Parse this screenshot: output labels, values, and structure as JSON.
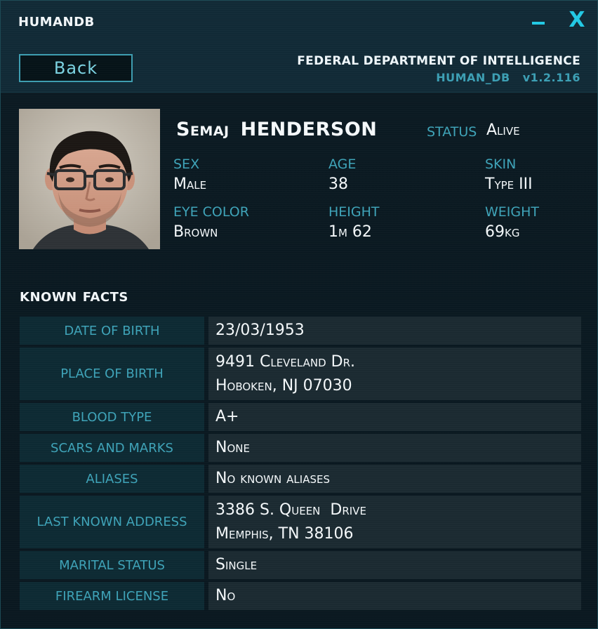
{
  "window": {
    "title": "HUMANDB",
    "minimize_glyph": "−",
    "close_glyph": "X"
  },
  "header": {
    "back_label": "Back",
    "agency": "FEDERAL DEPARTMENT OF INTELLIGENCE",
    "db_name": "HUMAN_DB",
    "version": "v1.2.116"
  },
  "profile": {
    "photo_icon": "person-photo",
    "first_name": "Semaj",
    "last_name": "HENDERSON",
    "status_label": "STATUS",
    "status_value": "Alive",
    "attributes": {
      "sex": {
        "label": "SEX",
        "value": "Male"
      },
      "age": {
        "label": "AGE",
        "value": "38"
      },
      "skin": {
        "label": "SKIN",
        "value": "Type III"
      },
      "eye": {
        "label": "EYE COLOR",
        "value": "Brown"
      },
      "height": {
        "label": "HEIGHT",
        "value": "1m 62"
      },
      "weight": {
        "label": "WEIGHT",
        "value": "69kg"
      }
    }
  },
  "facts": {
    "title_1": "KNOWN",
    "title_2": "FACTS",
    "rows": [
      {
        "label": "DATE OF BIRTH",
        "lines": [
          "23/03/1953"
        ]
      },
      {
        "label": "PLACE OF BIRTH",
        "lines": [
          "9491 Cleveland Dr.",
          "Hoboken, NJ 07030"
        ]
      },
      {
        "label": "BLOOD TYPE",
        "lines": [
          "A+"
        ]
      },
      {
        "label": "SCARS AND MARKS",
        "lines": [
          "None"
        ]
      },
      {
        "label": "ALIASES",
        "lines": [
          "No known aliases"
        ]
      },
      {
        "label": "LAST KNOWN ADDRESS",
        "lines": [
          "3386 S. Queen  Drive",
          "Memphis, TN 38106"
        ]
      },
      {
        "label": "MARITAL STATUS",
        "lines": [
          "Single"
        ]
      },
      {
        "label": "FIREARM LICENSE",
        "lines": [
          "No"
        ]
      }
    ]
  },
  "colors": {
    "accent": "#22c9e4",
    "label": "#3ea3b8",
    "label_cell": "#0d2a33",
    "value_cell": "#1b2a31"
  }
}
